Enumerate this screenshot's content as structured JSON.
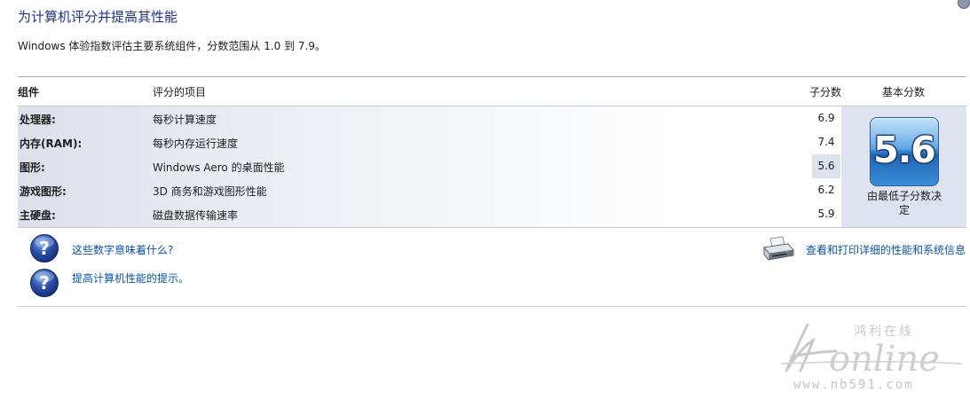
{
  "header": {
    "title": "为计算机评分并提高其性能",
    "subtitle": "Windows 体验指数评估主要系统组件，分数范围从 1.0 到 7.9。"
  },
  "table": {
    "columns": {
      "component": "组件",
      "rated_item": "评分的项目",
      "subscore": "子分数",
      "base_score": "基本分数"
    },
    "rows": [
      {
        "component": "处理器:",
        "item": "每秒计算速度",
        "subscore": "6.9"
      },
      {
        "component": "内存(RAM):",
        "item": "每秒内存运行速度",
        "subscore": "7.4"
      },
      {
        "component": "图形:",
        "item": "Windows Aero 的桌面性能",
        "subscore": "5.6"
      },
      {
        "component": "游戏图形:",
        "item": "3D 商务和游戏图形性能",
        "subscore": "6.2"
      },
      {
        "component": "主硬盘:",
        "item": "磁盘数据传输速率",
        "subscore": "5.9"
      }
    ],
    "base_score": {
      "value": "5.6",
      "caption": "由最低子分数决定"
    }
  },
  "links": {
    "what_numbers_mean": "这些数字意味着什么?",
    "improve_tips": "提高计算机性能的提示。",
    "view_print_details": "查看和打印详细的性能和系统信息"
  },
  "icons": {
    "help": "help-question-icon",
    "printer": "printer-icon",
    "badge": "score-badge"
  },
  "watermark": {
    "brand": "Honline",
    "tagline": "鸿利在线",
    "url": "www.nb591.com"
  },
  "colors": {
    "title": "#1e3287",
    "link": "#0a53a8",
    "badge": "#3c8ed8",
    "help_icon": "#2b4fa8"
  }
}
